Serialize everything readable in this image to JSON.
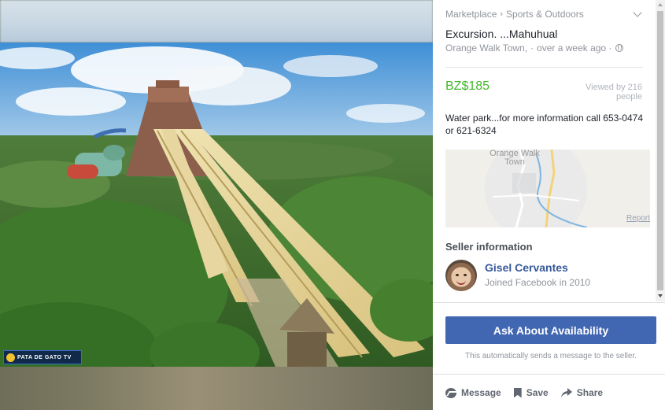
{
  "breadcrumb": {
    "root": "Marketplace",
    "separator": "›",
    "category": "Sports & Outdoors"
  },
  "listing": {
    "title": "Excursion. ...Mahuhual",
    "location": "Orange Walk Town,",
    "dot": "·",
    "posted": "over a week ago ·",
    "price": "BZ$185",
    "views": "Viewed by 216 people",
    "description": "Water park...for more information call 653-0474 or 621-6324"
  },
  "map": {
    "label": "Orange Walk Town",
    "report": "Report"
  },
  "seller": {
    "heading": "Seller information",
    "name": "Gisel Cervantes",
    "joined": "Joined Facebook in 2010"
  },
  "cta": {
    "ask_label": "Ask About Availability",
    "note": "This automatically sends a message to the seller."
  },
  "actions": {
    "message": "Message",
    "save": "Save",
    "share": "Share"
  },
  "photo": {
    "watermark": "PATA DE GATO TV"
  },
  "colors": {
    "price": "#42b72a",
    "primary": "#4267b2",
    "link": "#365899"
  }
}
